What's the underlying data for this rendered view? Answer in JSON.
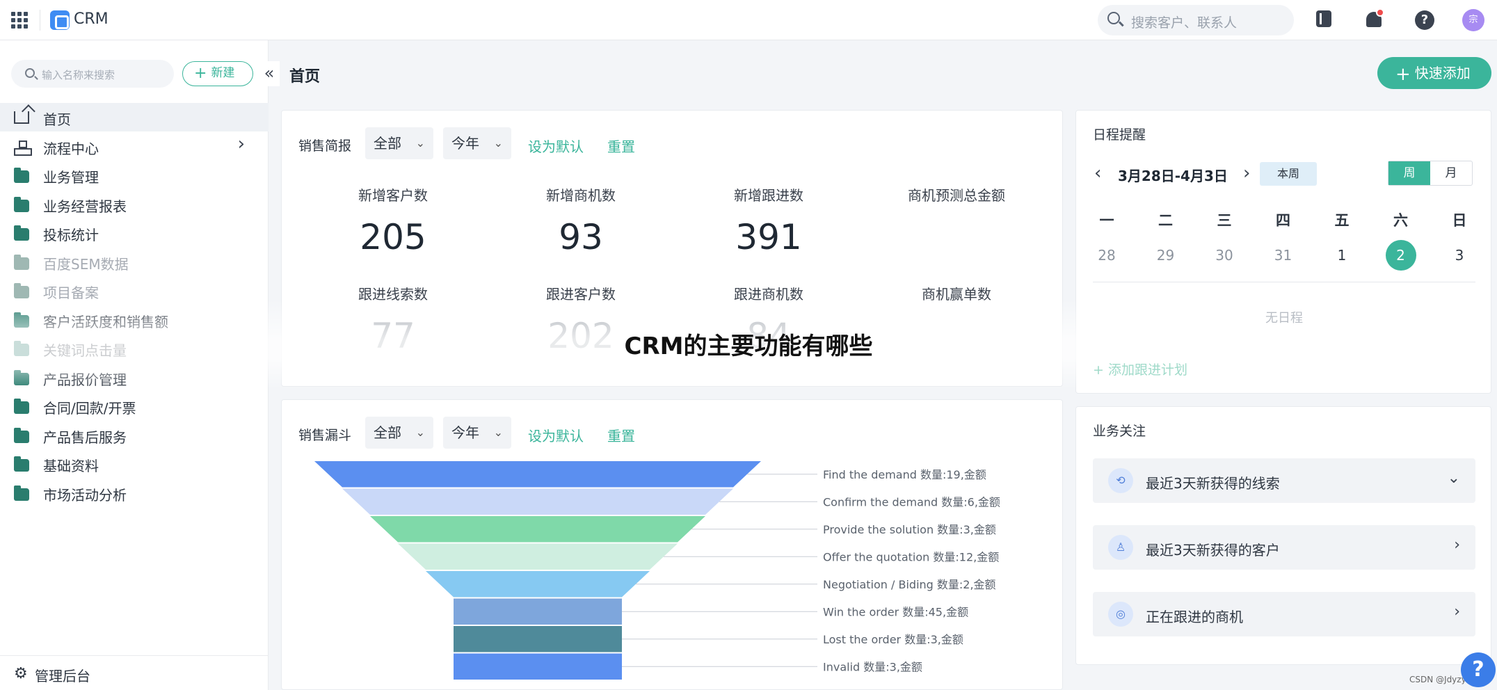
{
  "topbar": {
    "brand": "CRM",
    "search_placeholder": "搜索客户、联系人",
    "avatar_text": "宗"
  },
  "sidebar": {
    "search_placeholder": "输入名称来搜索",
    "new_label": "新建",
    "collapse_glyph": "«",
    "items": [
      {
        "label": "首页",
        "icon": "home-icon",
        "active": true
      },
      {
        "label": "流程中心",
        "icon": "flow-icon",
        "has_arrow": true
      },
      {
        "label": "业务管理",
        "icon": "folder-icon"
      },
      {
        "label": "业务经营报表",
        "icon": "folder-icon"
      },
      {
        "label": "投标统计",
        "icon": "folder-icon"
      },
      {
        "label": "百度SEM数据",
        "icon": "folder-icon",
        "dim": true
      },
      {
        "label": "项目备案",
        "icon": "folder-icon",
        "dim": true
      },
      {
        "label": "客户活跃度和销售额",
        "icon": "folder-icon"
      },
      {
        "label": "关键词点击量",
        "icon": "folder-icon"
      },
      {
        "label": "产品报价管理",
        "icon": "folder-icon"
      },
      {
        "label": "合同/回款/开票",
        "icon": "folder-icon"
      },
      {
        "label": "产品售后服务",
        "icon": "folder-icon"
      },
      {
        "label": "基础资料",
        "icon": "folder-icon"
      },
      {
        "label": "市场活动分析",
        "icon": "folder-icon"
      }
    ],
    "admin_label": "管理后台"
  },
  "main": {
    "page_title": "首页",
    "quick_add_label": "快速添加",
    "overlay_title": "CRM的主要功能有哪些"
  },
  "sales_brief": {
    "title": "销售简报",
    "filter_scope": "全部",
    "filter_period": "今年",
    "set_default": "设为默认",
    "reset": "重置",
    "kpis": [
      {
        "label": "新增客户数",
        "value": "205"
      },
      {
        "label": "新增商机数",
        "value": "93"
      },
      {
        "label": "新增跟进数",
        "value": "391"
      },
      {
        "label": "商机预测总金额",
        "value": ""
      },
      {
        "label": "跟进线索数",
        "value": "77"
      },
      {
        "label": "跟进客户数",
        "value": "202"
      },
      {
        "label": "跟进商机数",
        "value": "84"
      },
      {
        "label": "商机赢单数",
        "value": ""
      }
    ]
  },
  "funnel": {
    "title": "销售漏斗",
    "filter_scope": "全部",
    "filter_period": "今年",
    "set_default": "设为默认",
    "reset": "重置",
    "stages": [
      {
        "label": "Find the demand 数量:19,金额",
        "count": 19,
        "color": "#5b8ff0"
      },
      {
        "label": "Confirm the demand 数量:6,金额",
        "count": 6,
        "color": "#c9d8f8"
      },
      {
        "label": "Provide the solution 数量:3,金额",
        "count": 3,
        "color": "#7fd9a9"
      },
      {
        "label": "Offer the quotation 数量:12,金额",
        "count": 12,
        "color": "#cfeee0"
      },
      {
        "label": "Negotiation / Biding 数量:2,金额",
        "count": 2,
        "color": "#86c9f2"
      },
      {
        "label": "Win the order 数量:45,金额",
        "count": 45,
        "color": "#7ea6dc"
      },
      {
        "label": "Lost the order 数量:3,金额",
        "count": 3,
        "color": "#4f8a9a"
      },
      {
        "label": "Invalid 数量:3,金额",
        "count": 3,
        "color": "#5b8ff0"
      }
    ]
  },
  "schedule": {
    "title": "日程提醒",
    "range": "3月28日-4月3日",
    "this_week": "本周",
    "view_week": "周",
    "view_month": "月",
    "weekdays": [
      "一",
      "二",
      "三",
      "四",
      "五",
      "六",
      "日"
    ],
    "days": [
      {
        "d": "28",
        "type": "other"
      },
      {
        "d": "29",
        "type": "other"
      },
      {
        "d": "30",
        "type": "other"
      },
      {
        "d": "31",
        "type": "other"
      },
      {
        "d": "1",
        "type": "cur"
      },
      {
        "d": "2",
        "type": "selected"
      },
      {
        "d": "3",
        "type": "cur"
      }
    ],
    "empty_text": "无日程",
    "add_plan": "+ 添加跟进计划"
  },
  "focus": {
    "title": "业务关注",
    "items": [
      {
        "label": "最近3天新获得的线索",
        "icon": "lead-icon",
        "arrow": "⌄"
      },
      {
        "label": "最近3天新获得的客户",
        "icon": "customer-icon",
        "arrow": "›"
      },
      {
        "label": "正在跟进的商机",
        "icon": "opportunity-icon",
        "arrow": "›"
      }
    ]
  },
  "footer": {
    "watermark": "CSDN @Jdyzy",
    "help_glyph": "?"
  }
}
